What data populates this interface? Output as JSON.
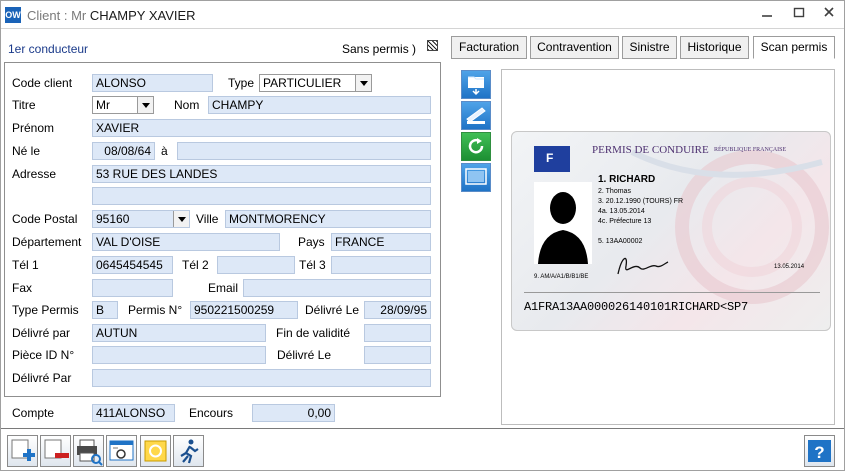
{
  "window": {
    "app_badge": "OW",
    "title_prefix": "Client : Mr ",
    "title_name": "CHAMPY XAVIER",
    "controls": [
      "minimize-icon",
      "maximize-icon",
      "close-icon"
    ]
  },
  "header": {
    "driver_label": "1er conducteur",
    "sans_permis_label": "Sans permis )"
  },
  "tabs": [
    {
      "label": "Facturation",
      "active": false
    },
    {
      "label": "Contravention",
      "active": false
    },
    {
      "label": "Sinistre",
      "active": false
    },
    {
      "label": "Historique",
      "active": false
    },
    {
      "label": "Scan permis",
      "active": true
    }
  ],
  "form": {
    "code_client_label": "Code client",
    "code_client": "ALONSO",
    "type_label": "Type",
    "type_value": "PARTICULIER",
    "titre_label": "Titre",
    "titre_value": "Mr",
    "nom_label": "Nom",
    "nom": "CHAMPY",
    "prenom_label": "Prénom",
    "prenom": "XAVIER",
    "ne_le_label": "Né le",
    "ne_le": "08/08/64",
    "a_label": "à",
    "lieu_naissance": "",
    "adresse_label": "Adresse",
    "adresse1": "53 RUE DES LANDES",
    "adresse2": "",
    "code_postal_label": "Code Postal",
    "code_postal": "95160",
    "ville_label": "Ville",
    "ville": "MONTMORENCY",
    "departement_label": "Département",
    "departement": "VAL D'OISE",
    "pays_label": "Pays",
    "pays": "FRANCE",
    "tel1_label": "Tél 1",
    "tel1": "0645454545",
    "tel2_label": "Tél 2",
    "tel2": "",
    "tel3_label": "Tél 3",
    "tel3": "",
    "fax_label": "Fax",
    "fax": "",
    "email_label": "Email",
    "email": "",
    "type_permis_label": "Type Permis",
    "type_permis": "B",
    "permis_no_label": "Permis N°",
    "permis_no": "950221500259",
    "delivre_le_label": "Délivré Le",
    "delivre_le": "28/09/95",
    "delivre_par_label": "Délivré par",
    "delivre_par": "AUTUN",
    "fin_validite_label": "Fin de validité",
    "fin_validite": "",
    "piece_id_label": "Pièce ID N°",
    "piece_id": "",
    "delivre_le2_label": "Délivré Le",
    "delivre_le2": "",
    "delivre_par2_label": "Délivré Par",
    "delivre_par2": ""
  },
  "footer_fields": {
    "compte_label": "Compte",
    "compte": "411ALONSO",
    "encours_label": "Encours",
    "encours": "0,00"
  },
  "scan_tools": [
    "scan-folder-icon",
    "scanner-icon",
    "refresh-icon",
    "monitor-icon"
  ],
  "card": {
    "title": "PERMIS DE CONDUIRE",
    "republic": "RÉPUBLIQUE FRANÇAISE",
    "country_code": "F",
    "line1": "1. RICHARD",
    "line2": "2. Thomas",
    "line3": "3. 20.12.1990 (TOURS) FR",
    "line4a": "4a. 13.05.2014",
    "line4c": "4c. Préfecture 13",
    "line5": "5. 13AA00002",
    "line9": "9. AM/A/A1/B/B1/BE",
    "date_right": "13.05.2014",
    "mrz": "A1FRA13AA000026140101RICHARD<SP7"
  },
  "toolbar": [
    "add-icon",
    "remove-icon",
    "print-preview-icon",
    "vehicle-card-icon",
    "circle-o-icon",
    "running-man-icon"
  ],
  "help_icon": "help-icon",
  "colors": {
    "field_bg": "#dde8f7",
    "accent": "#1a63b8"
  }
}
